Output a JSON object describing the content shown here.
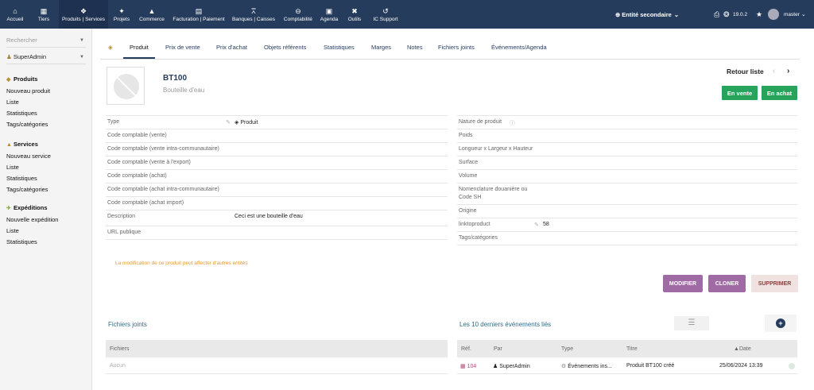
{
  "topbar": {
    "menu": [
      {
        "icon": "home-icon",
        "glyph": "⌂",
        "label": "Accueil"
      },
      {
        "icon": "building-icon",
        "glyph": "▦",
        "label": "Tiers"
      },
      {
        "icon": "cube-icon",
        "glyph": "❖",
        "label": "Produits | Services"
      },
      {
        "icon": "projects-icon",
        "glyph": "✦",
        "label": "Projets"
      },
      {
        "icon": "commerce-icon",
        "glyph": "▲",
        "label": "Commerce"
      },
      {
        "icon": "invoice-icon",
        "glyph": "▤",
        "label": "Facturation | Paiement"
      },
      {
        "icon": "bank-icon",
        "glyph": "⩞",
        "label": "Banques | Caisses"
      },
      {
        "icon": "accounting-icon",
        "glyph": "⊖",
        "label": "Comptabilité"
      },
      {
        "icon": "agenda-icon",
        "glyph": "▣",
        "label": "Agenda"
      },
      {
        "icon": "tools-icon",
        "glyph": "✖",
        "label": "Outils"
      },
      {
        "icon": "support-icon",
        "glyph": "↺",
        "label": "IC Support"
      }
    ],
    "entity": "Entité secondaire",
    "version": "19.0.2",
    "user": "master"
  },
  "sidebar": {
    "search_placeholder": "Rechercher",
    "user": "SuperAdmin",
    "groups": [
      {
        "title": "Produits",
        "icon": "cube-icon",
        "items": [
          "Nouveau produit",
          "Liste",
          "Statistiques",
          "Tags/catégories"
        ]
      },
      {
        "title": "Services",
        "icon": "service-icon",
        "items": [
          "Nouveau service",
          "Liste",
          "Statistiques",
          "Tags/catégories"
        ]
      },
      {
        "title": "Expéditions",
        "icon": "shipping-icon",
        "items": [
          "Nouvelle expédition",
          "Liste",
          "Statistiques"
        ]
      }
    ]
  },
  "tabs": [
    "Produit",
    "Prix de vente",
    "Prix d'achat",
    "Objets référents",
    "Statistiques",
    "Marges",
    "Notes",
    "Fichiers joints",
    "Événements/Agenda"
  ],
  "product": {
    "ref": "BT100",
    "label": "Bouteille d'eau",
    "back_list": "Retour liste",
    "prev": "‹",
    "next": "›",
    "badge_sell": "En vente",
    "badge_buy": "En achat"
  },
  "left_fields": [
    {
      "key": "Type",
      "value": "Produit"
    },
    {
      "key": "Code comptable (vente)",
      "value": ""
    },
    {
      "key": "Code comptable (vente intra-communautaire)",
      "value": ""
    },
    {
      "key": "Code comptable (vente à l'export)",
      "value": ""
    },
    {
      "key": "Code comptable (achat)",
      "value": ""
    },
    {
      "key": "Code comptable (achat intra-communautaire)",
      "value": ""
    },
    {
      "key": "Code comptable (achat import)",
      "value": ""
    },
    {
      "key": "Description",
      "value": "Ceci est une bouteille d'eau"
    },
    {
      "key": "URL publique",
      "value": ""
    }
  ],
  "right_fields": [
    {
      "key": "Nature de produit",
      "value": ""
    },
    {
      "key": "Poids",
      "value": ""
    },
    {
      "key": "Longueur x Largeur x Hauteur",
      "value": ""
    },
    {
      "key": "Surface",
      "value": ""
    },
    {
      "key": "Volume",
      "value": ""
    },
    {
      "key": "Nomenclature douanière ou",
      "key2": "Code SH",
      "value": ""
    },
    {
      "key": "Origine",
      "value": ""
    },
    {
      "key": "linktoproduct",
      "value": "58"
    },
    {
      "key": "Tags/catégories",
      "value": ""
    }
  ],
  "hint": "La modification de ce produit peut affecter d'autres entités",
  "actions": {
    "modify": "MODIFIER",
    "clone": "CLONER",
    "delete": "SUPPRIMER"
  },
  "files": {
    "title": "Fichiers joints",
    "header": "Fichiers",
    "empty": "Aucun"
  },
  "events": {
    "title": "Les 10 derniers événements liés",
    "headers": {
      "ref": "Réf.",
      "by": "Par",
      "type": "Type",
      "title": "Titre",
      "date": "Date"
    },
    "rows": [
      {
        "ref": "104",
        "by": "SuperAdmin",
        "type": "Événements ins...",
        "title": "Produit BT100 créé",
        "date": "25/06/2024 13:39"
      }
    ]
  },
  "colors": {
    "topbar": "#263c5c",
    "green": "#27a35b",
    "purple": "#a06aa4",
    "link": "#2c6f8a",
    "warning": "#e39a2a"
  }
}
